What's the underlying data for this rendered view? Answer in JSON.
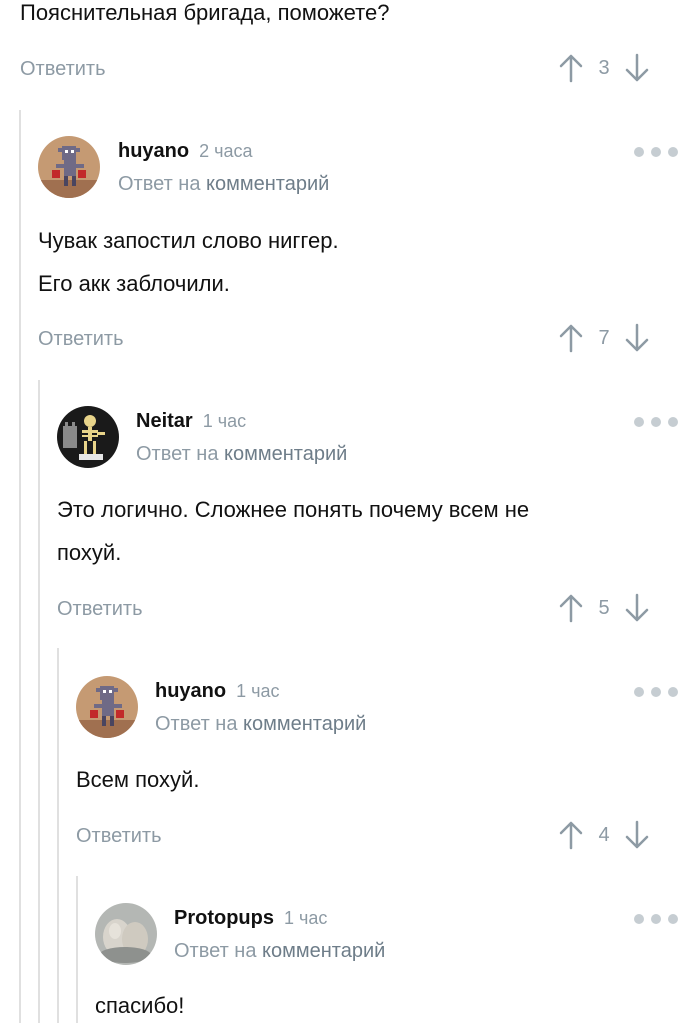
{
  "top": {
    "text": "Пояснительная бригада, поможете?",
    "reply_label": "Ответить",
    "rating": "3"
  },
  "comments": [
    {
      "author": "huyano",
      "time": "2 часа",
      "reply_prefix": "Ответ на",
      "reply_link": "комментарий",
      "lines": [
        "Чувак запостил слово ниггер.",
        "Его акк заблочили."
      ],
      "reply_label": "Ответить",
      "rating": "7",
      "avatar": "pixel-goblin-avatar"
    },
    {
      "author": "Neitar",
      "time": "1 час",
      "reply_prefix": "Ответ на",
      "reply_link": "комментарий",
      "lines": [
        "Это логично. Сложнее понять почему всем не",
        "похуй."
      ],
      "reply_label": "Ответить",
      "rating": "5",
      "avatar": "skeleton-avatar"
    },
    {
      "author": "huyano",
      "time": "1 час",
      "reply_prefix": "Ответ на",
      "reply_link": "комментарий",
      "lines": [
        "Всем похуй."
      ],
      "reply_label": "Ответить",
      "rating": "4",
      "avatar": "pixel-goblin-avatar"
    },
    {
      "author": "Protopups",
      "time": "1 час",
      "reply_prefix": "Ответ на",
      "reply_link": "комментарий",
      "lines": [
        "спасибо!"
      ],
      "avatar": "stones-avatar"
    }
  ],
  "colors": {
    "muted": "#8d9aa4",
    "text": "#111111",
    "thread_line": "#e0e0e0",
    "dots": "#c6cdd2"
  }
}
